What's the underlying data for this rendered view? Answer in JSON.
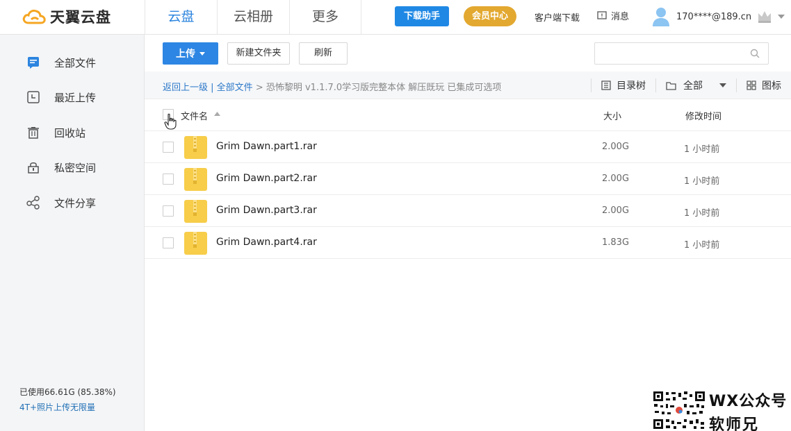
{
  "header": {
    "logo_text": "天翼云盘",
    "nav": [
      {
        "label": "云盘",
        "active": true
      },
      {
        "label": "云相册",
        "active": false
      },
      {
        "label": "更多",
        "active": false
      }
    ],
    "download_helper": "下载助手",
    "vip_center": "会员中心",
    "client_download": "客户端下载",
    "messages": "消息",
    "user_account": "170****@189.cn"
  },
  "sidebar": {
    "items": [
      {
        "label": "全部文件",
        "icon": "all-files-icon"
      },
      {
        "label": "最近上传",
        "icon": "clock-icon"
      },
      {
        "label": "回收站",
        "icon": "trash-icon"
      },
      {
        "label": "私密空间",
        "icon": "lock-icon"
      },
      {
        "label": "文件分享",
        "icon": "share-icon"
      }
    ],
    "usage": "已使用66.61G (85.38%)",
    "upgrade": "4T+照片上传无限量"
  },
  "toolbar": {
    "upload": "上传",
    "new_folder": "新建文件夹",
    "refresh": "刷新",
    "search_placeholder": ""
  },
  "breadcrumb": {
    "back": "返回上一级",
    "divider": " | ",
    "root": "全部文件",
    "arrow": " > ",
    "current": "恐怖黎明 v1.1.7.0学习版完整本体 解压既玩 已集成可选项"
  },
  "view_options": {
    "tree": "目录树",
    "filter": "全部",
    "icon_view": "图标"
  },
  "table": {
    "col_name": "文件名",
    "col_size": "大小",
    "col_time": "修改时间",
    "rows": [
      {
        "name": "Grim Dawn.part1.rar",
        "size": "2.00G",
        "time": "1 小时前"
      },
      {
        "name": "Grim Dawn.part2.rar",
        "size": "2.00G",
        "time": "1 小时前"
      },
      {
        "name": "Grim Dawn.part3.rar",
        "size": "2.00G",
        "time": "1 小时前"
      },
      {
        "name": "Grim Dawn.part4.rar",
        "size": "1.83G",
        "time": "1 小时前"
      }
    ]
  },
  "watermark": {
    "line1": "WX公众号",
    "line2": "软师兄"
  },
  "colors": {
    "accent": "#2d85df",
    "vip": "#e3a830",
    "rar": "#f5c842"
  }
}
